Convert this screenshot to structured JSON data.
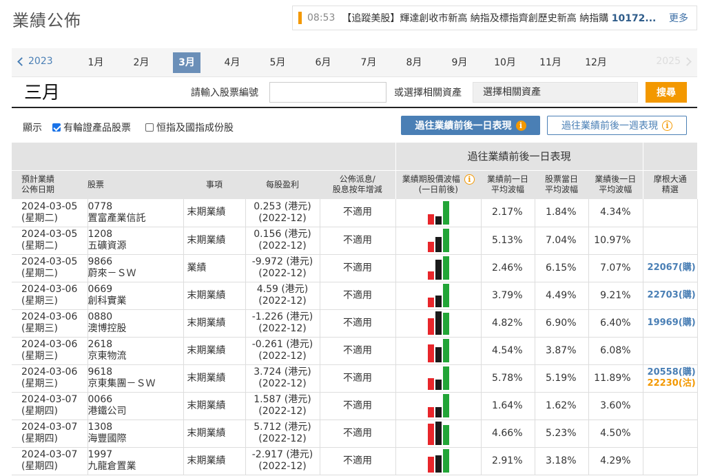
{
  "page_title": "業績公佈",
  "ticker": {
    "time": "08:53",
    "text": "【追蹤美股】輝達創收市新高 納指及標指齊創歷史新高 納指購 ",
    "highlight": "10172...",
    "more": "更多"
  },
  "months": {
    "prev_year": "2023",
    "next_year": "2025",
    "items": [
      "1月",
      "2月",
      "3月",
      "4月",
      "5月",
      "6月",
      "7月",
      "8月",
      "9月",
      "10月",
      "11月",
      "12月"
    ],
    "active": "3月"
  },
  "current_month": "三月",
  "search": {
    "stock_label": "請輸入股票編號",
    "stock_value": "",
    "asset_label": "或選擇相關資產",
    "asset_select": "選擇相關資產",
    "button": "搜尋"
  },
  "filters": {
    "show_label": "顯示",
    "opt1": "有輪證產品股票",
    "opt1_checked": true,
    "opt2": "恒指及國指成份股",
    "opt2_checked": false
  },
  "view_buttons": {
    "one_day": "過往業績前後一日表現",
    "one_week": "過往業績前後一週表現"
  },
  "table": {
    "group_header": "過往業績前後一日表現",
    "headers": {
      "date_l1": "預計業績",
      "date_l2": "公佈日期",
      "stock": "股票",
      "event": "事項",
      "eps": "每股盈利",
      "div_l1": "公佈派息/",
      "div_l2": "股息按年增減",
      "chart_l1": "業績期股價波幅",
      "chart_l2": "(一日前後)",
      "pre_l1": "業績前一日",
      "pre_l2": "平均波幅",
      "day_l1": "股票當日",
      "day_l2": "平均波幅",
      "post_l1": "業績後一日",
      "post_l2": "平均波幅",
      "mg_l1": "摩根大通",
      "mg_l2": "精選"
    },
    "rows": [
      {
        "date": "2024-03-05",
        "weekday": "(星期二)",
        "code": "0778",
        "name": "置富產業信託",
        "event": "末期業績",
        "eps": "0.253 (港元)",
        "eps_period": "(2022-12)",
        "dividend": "不適用",
        "bars": [
          0.45,
          0.35,
          1.0
        ],
        "pre": "2.17%",
        "day": "1.84%",
        "post": "4.34%",
        "mg": [],
        "mg_put": ""
      },
      {
        "date": "2024-03-05",
        "weekday": "(星期二)",
        "code": "1208",
        "name": "五礦資源",
        "event": "末期業績",
        "eps": "0.156 (港元)",
        "eps_period": "(2022-12)",
        "dividend": "不適用",
        "bars": [
          0.45,
          0.65,
          1.0
        ],
        "pre": "5.13%",
        "day": "7.04%",
        "post": "10.97%",
        "mg": [],
        "mg_put": ""
      },
      {
        "date": "2024-03-05",
        "weekday": "(星期二)",
        "code": "9866",
        "name": "蔚來－ＳＷ",
        "event": "業績",
        "eps": "-9.972 (港元)",
        "eps_period": "(2022-12)",
        "dividend": "不適用",
        "bars": [
          0.35,
          0.85,
          1.0
        ],
        "pre": "2.46%",
        "day": "6.15%",
        "post": "7.07%",
        "mg": [
          "22067(購)"
        ],
        "mg_put": ""
      },
      {
        "date": "2024-03-06",
        "weekday": "(星期三)",
        "code": "0669",
        "name": "創科實業",
        "event": "末期業績",
        "eps": "4.59 (港元)",
        "eps_period": "(2022-12)",
        "dividend": "不適用",
        "bars": [
          0.4,
          0.5,
          1.0
        ],
        "pre": "3.79%",
        "day": "4.49%",
        "post": "9.21%",
        "mg": [
          "22703(購)"
        ],
        "mg_put": ""
      },
      {
        "date": "2024-03-06",
        "weekday": "(星期三)",
        "code": "0880",
        "name": "澳博控股",
        "event": "末期業績",
        "eps": "-1.226 (港元)",
        "eps_period": "(2022-12)",
        "dividend": "不適用",
        "bars": [
          0.7,
          1.0,
          0.93
        ],
        "pre": "4.82%",
        "day": "6.90%",
        "post": "6.40%",
        "mg": [
          "19969(購)"
        ],
        "mg_put": ""
      },
      {
        "date": "2024-03-06",
        "weekday": "(星期三)",
        "code": "2618",
        "name": "京東物流",
        "event": "末期業績",
        "eps": "-0.261 (港元)",
        "eps_period": "(2022-12)",
        "dividend": "不適用",
        "bars": [
          0.75,
          0.64,
          1.0
        ],
        "pre": "4.54%",
        "day": "3.87%",
        "post": "6.08%",
        "mg": [],
        "mg_put": ""
      },
      {
        "date": "2024-03-06",
        "weekday": "(星期三)",
        "code": "9618",
        "name": "京東集團－ＳＷ",
        "event": "末期業績",
        "eps": "3.724 (港元)",
        "eps_period": "(2022-12)",
        "dividend": "不適用",
        "bars": [
          0.49,
          0.44,
          1.0
        ],
        "pre": "5.78%",
        "day": "5.19%",
        "post": "11.89%",
        "mg": [
          "20558(購)"
        ],
        "mg_put": "22230(沽)"
      },
      {
        "date": "2024-03-07",
        "weekday": "(星期四)",
        "code": "0066",
        "name": "港鐵公司",
        "event": "末期業績",
        "eps": "1.587 (港元)",
        "eps_period": "(2022-12)",
        "dividend": "不適用",
        "bars": [
          0.45,
          0.45,
          1.0
        ],
        "pre": "1.64%",
        "day": "1.62%",
        "post": "3.60%",
        "mg": [],
        "mg_put": ""
      },
      {
        "date": "2024-03-07",
        "weekday": "(星期四)",
        "code": "1308",
        "name": "海豐國際",
        "event": "末期業績",
        "eps": "5.712 (港元)",
        "eps_period": "(2022-12)",
        "dividend": "不適用",
        "bars": [
          0.9,
          1.0,
          0.86
        ],
        "pre": "4.66%",
        "day": "5.23%",
        "post": "4.50%",
        "mg": [],
        "mg_put": ""
      },
      {
        "date": "2024-03-07",
        "weekday": "(星期四)",
        "code": "1997",
        "name": "九龍倉置業",
        "event": "末期業績",
        "eps": "-2.917 (港元)",
        "eps_period": "(2022-12)",
        "dividend": "不適用",
        "bars": [
          0.68,
          0.74,
          1.0
        ],
        "pre": "2.91%",
        "day": "3.18%",
        "post": "4.29%",
        "mg": [],
        "mg_put": ""
      }
    ]
  }
}
